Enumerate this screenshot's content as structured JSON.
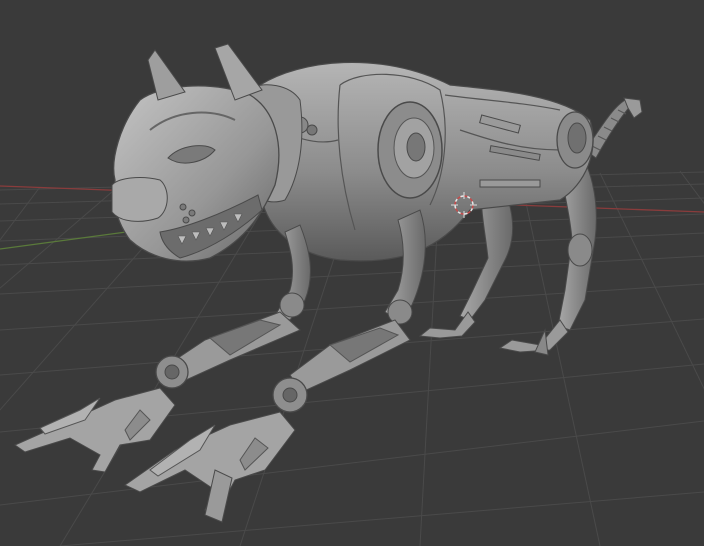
{
  "viewport": {
    "mode": "solid-shading",
    "background_color": "#3a3a3a",
    "grid_color": "#4a4a4a",
    "x_axis_color": "#8a3c3c",
    "y_axis_color": "#5a7a3a",
    "cursor_color": "#c84a4a"
  },
  "model": {
    "subject": "robotic-panther",
    "material_color": "#8e8e8e"
  },
  "icons": {
    "cursor": "3d-cursor-icon"
  }
}
